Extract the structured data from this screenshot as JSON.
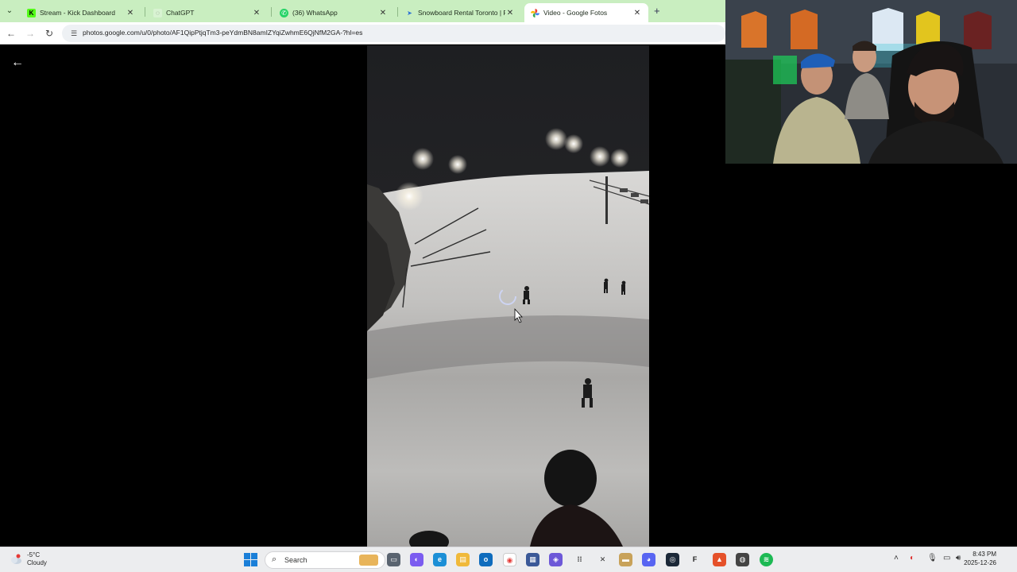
{
  "browser": {
    "tabs": [
      {
        "title": "Stream - Kick Dashboard",
        "icon": "kick-icon",
        "close": "✕"
      },
      {
        "title": "ChatGPT",
        "icon": "chatgpt-icon",
        "close": "✕"
      },
      {
        "title": "(36) WhatsApp",
        "icon": "whatsapp-icon",
        "close": "✕"
      },
      {
        "title": "Snowboard Rental Toronto | Re",
        "icon": "site-icon",
        "close": "✕"
      },
      {
        "title": "Video - Google Fotos",
        "icon": "google-photos-icon",
        "close": "✕"
      }
    ],
    "new_tab": "+",
    "url": "photos.google.com/u/0/photo/AF1QipPtjqTm3-peYdmBN8amIZYqiZwhmE6QjNfM2GA-?hl=es",
    "colors": {
      "tabbar": "#c9eec0",
      "kick": "#53fc18",
      "whatsapp": "#25d366"
    }
  },
  "viewer": {
    "back_icon": "arrow-left-icon"
  },
  "taskbar": {
    "weather_temp": "-5°C",
    "weather_desc": "Cloudy",
    "search_label": "Search",
    "time": "8:43 PM",
    "date": "2025-12-26"
  }
}
